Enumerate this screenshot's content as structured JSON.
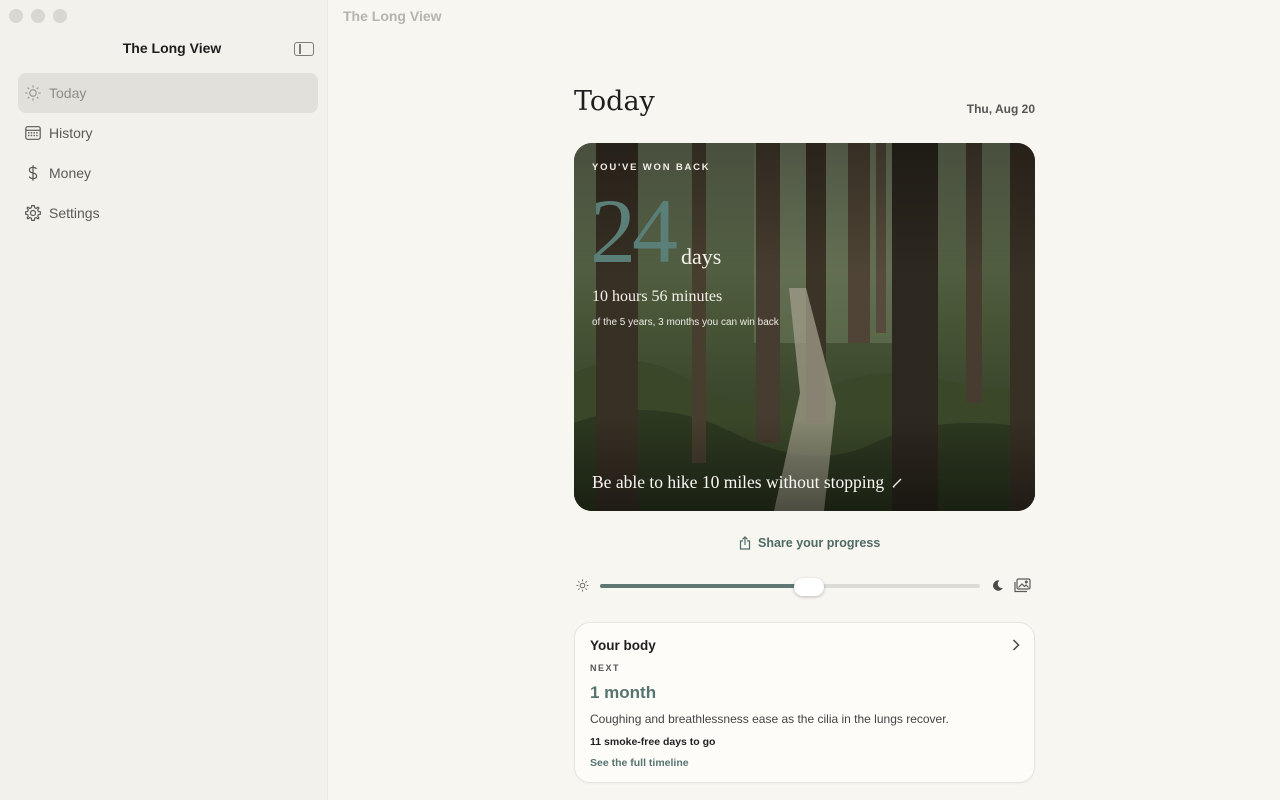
{
  "window": {
    "title": "The Long View"
  },
  "sidebar": {
    "title": "The Long View",
    "items": [
      {
        "label": "Today",
        "icon": "sun-icon",
        "active": true
      },
      {
        "label": "History",
        "icon": "calendar-icon",
        "active": false
      },
      {
        "label": "Money",
        "icon": "dollar-icon",
        "active": false
      },
      {
        "label": "Settings",
        "icon": "gear-icon",
        "active": false
      }
    ]
  },
  "main": {
    "title": "Today",
    "date": "Thu, Aug 20",
    "hero": {
      "kicker": "YOU'VE WON BACK",
      "number": "24",
      "unit": "days",
      "sub": "10 hours 56 minutes",
      "small": "of the 5 years, 3 months you can win back",
      "goal": "Be able to hike 10 miles without stopping"
    },
    "share_label": "Share your progress",
    "slider": {
      "value": 0.55
    },
    "card": {
      "title": "Your body",
      "next_label": "NEXT",
      "milestone": "1 month",
      "description": "Coughing and breathlessness ease as the cilia in the lungs recover.",
      "days_to_go": "11 smoke-free days to go",
      "link": "See the full timeline"
    }
  },
  "colors": {
    "accent": "#577470",
    "background": "#f8f6f0",
    "sidebar": "#f3f1eb"
  }
}
